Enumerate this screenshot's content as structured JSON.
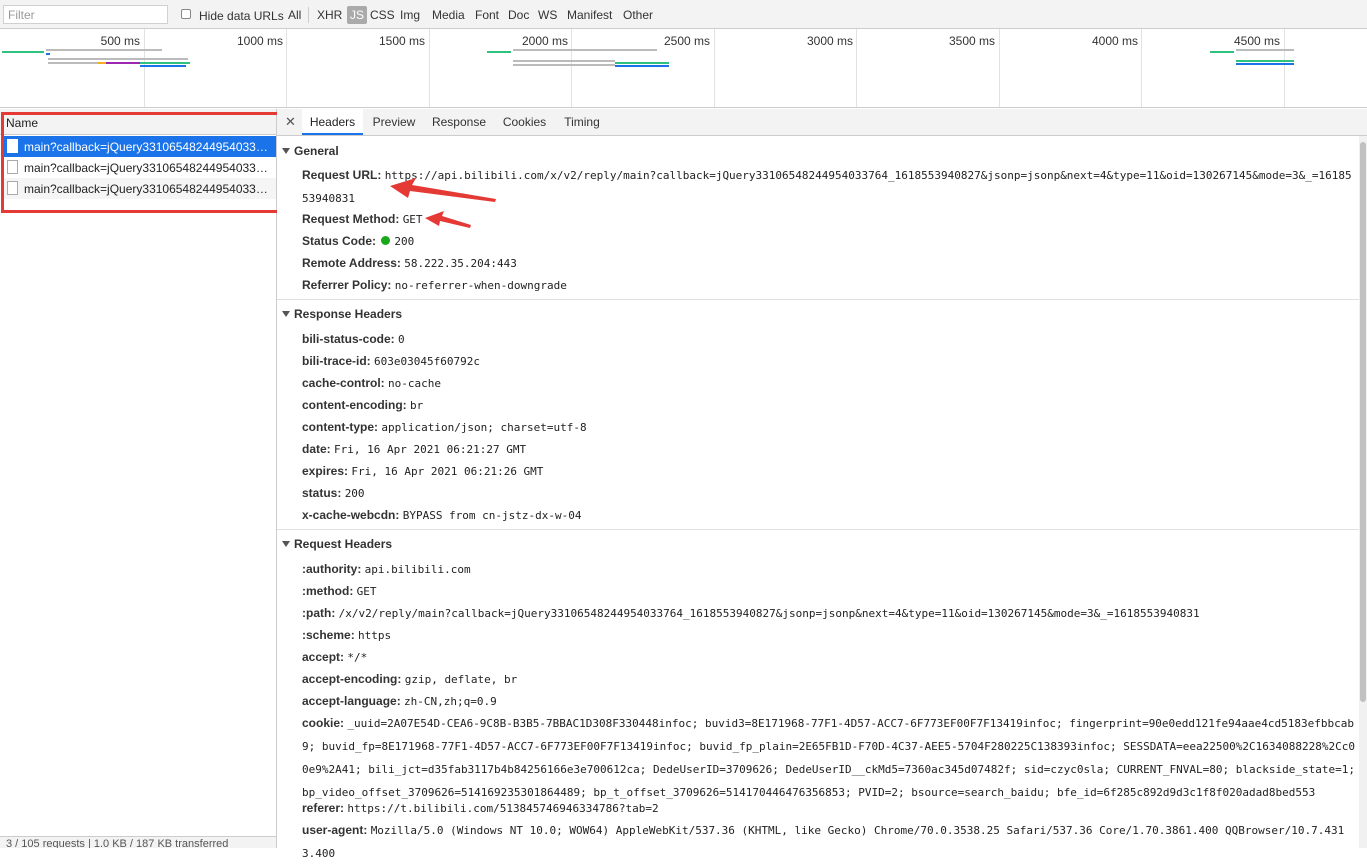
{
  "filterbar": {
    "filter_placeholder": "Filter",
    "hide_data_urls_label": "Hide data URLs",
    "types": [
      "All",
      "XHR",
      "JS",
      "CSS",
      "Img",
      "Media",
      "Font",
      "Doc",
      "WS",
      "Manifest",
      "Other"
    ],
    "selected_type": "JS"
  },
  "overview": {
    "ticks": [
      "500 ms",
      "1000 ms",
      "1500 ms",
      "2000 ms",
      "2500 ms",
      "3000 ms",
      "3500 ms",
      "4000 ms",
      "4500 ms"
    ]
  },
  "requests": {
    "column_header": "Name",
    "items": [
      "main?callback=jQuery331065482449540337...",
      "main?callback=jQuery331065482449540337...",
      "main?callback=jQuery331065482449540337..."
    ],
    "summary": "3 / 105 requests | 1.0 KB / 187 KB transferred"
  },
  "tabs": [
    "Headers",
    "Preview",
    "Response",
    "Cookies",
    "Timing"
  ],
  "active_tab": "Headers",
  "general": {
    "title": "General",
    "rows": [
      {
        "key": "Request URL:",
        "value": "https://api.bilibili.com/x/v2/reply/main?callback=jQuery33106548244954033764_1618553940827&jsonp=jsonp&next=4&type=11&oid=130267145&mode=3&_=1618553940831"
      },
      {
        "key": "Request Method:",
        "value": "GET"
      },
      {
        "key": "Status Code:",
        "value": "200"
      },
      {
        "key": "Remote Address:",
        "value": "58.222.35.204:443"
      },
      {
        "key": "Referrer Policy:",
        "value": "no-referrer-when-downgrade"
      }
    ]
  },
  "response_headers": {
    "title": "Response Headers",
    "rows": [
      {
        "key": "bili-status-code:",
        "value": "0"
      },
      {
        "key": "bili-trace-id:",
        "value": "603e03045f60792c"
      },
      {
        "key": "cache-control:",
        "value": "no-cache"
      },
      {
        "key": "content-encoding:",
        "value": "br"
      },
      {
        "key": "content-type:",
        "value": "application/json; charset=utf-8"
      },
      {
        "key": "date:",
        "value": "Fri, 16 Apr 2021 06:21:27 GMT"
      },
      {
        "key": "expires:",
        "value": "Fri, 16 Apr 2021 06:21:26 GMT"
      },
      {
        "key": "status:",
        "value": "200"
      },
      {
        "key": "x-cache-webcdn:",
        "value": "BYPASS from cn-jstz-dx-w-04"
      }
    ]
  },
  "request_headers": {
    "title": "Request Headers",
    "rows": [
      {
        "key": ":authority:",
        "value": "api.bilibili.com"
      },
      {
        "key": ":method:",
        "value": "GET"
      },
      {
        "key": ":path:",
        "value": "/x/v2/reply/main?callback=jQuery33106548244954033764_1618553940827&jsonp=jsonp&next=4&type=11&oid=130267145&mode=3&_=1618553940831"
      },
      {
        "key": ":scheme:",
        "value": "https"
      },
      {
        "key": "accept:",
        "value": "*/*"
      },
      {
        "key": "accept-encoding:",
        "value": "gzip, deflate, br"
      },
      {
        "key": "accept-language:",
        "value": "zh-CN,zh;q=0.9"
      },
      {
        "key": "cookie:",
        "value": "_uuid=2A07E54D-CEA6-9C8B-B3B5-7BBAC1D308F330448infoc; buvid3=8E171968-77F1-4D57-ACC7-6F773EF00F7F13419infoc; fingerprint=90e0edd121fe94aae4cd5183efbbcab9; buvid_fp=8E171968-77F1-4D57-ACC7-6F773EF00F7F13419infoc; buvid_fp_plain=2E65FB1D-F70D-4C37-AEE5-5704F280225C138393infoc; SESSDATA=eea22500%2C1634088228%2Cc00e9%2A41; bili_jct=d35fab3117b4b84256166e3e700612ca; DedeUserID=3709626; DedeUserID__ckMd5=7360ac345d07482f; sid=czyc0sla; CURRENT_FNVAL=80; blackside_state=1; bp_video_offset_3709626=514169235301864489; bp_t_offset_3709626=514170446476356853; PVID=2; bsource=search_baidu; bfe_id=6f285c892d9d3c1f8f020adad8bed553"
      },
      {
        "key": "referer:",
        "value": "https://t.bilibili.com/513845746946334786?tab=2"
      },
      {
        "key": "user-agent:",
        "value": "Mozilla/5.0 (Windows NT 10.0; WOW64) AppleWebKit/537.36 (KHTML, like Gecko) Chrome/70.0.3538.25 Safari/537.36 Core/1.70.3861.400 QQBrowser/10.7.4313.400"
      }
    ]
  },
  "colors": {
    "selected_row": "#1a73e8",
    "annotation_red": "#e53935",
    "status_green": "#1aa81a"
  }
}
